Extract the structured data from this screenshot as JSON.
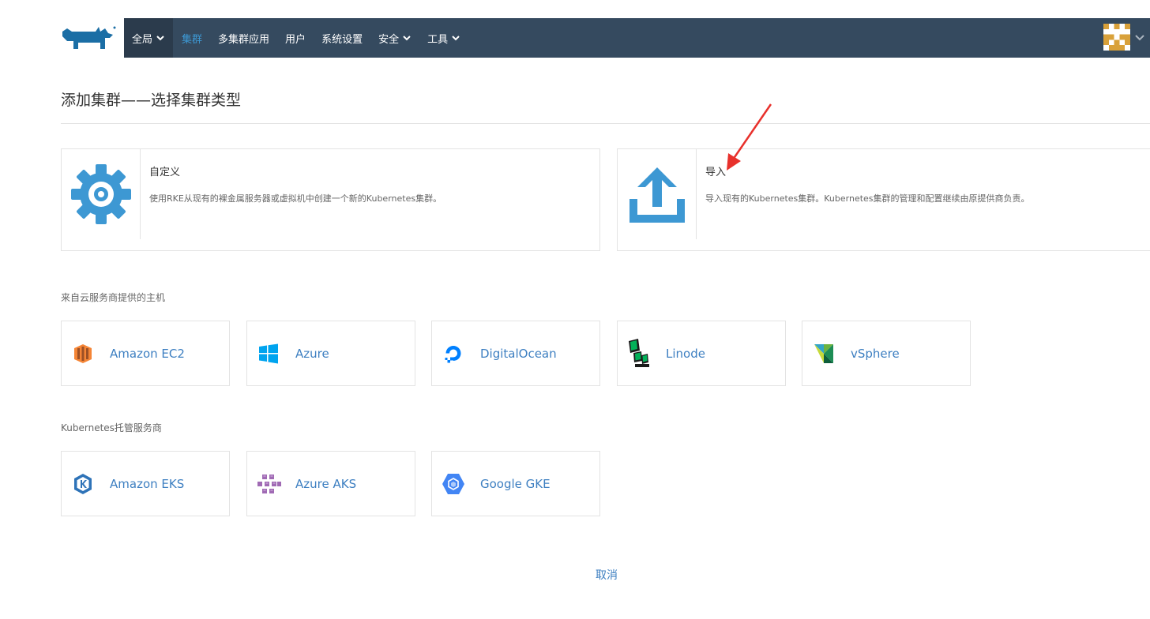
{
  "nav": {
    "global": "全局",
    "clusters": "集群",
    "multi_cluster_apps": "多集群应用",
    "users": "用户",
    "settings": "系统设置",
    "security": "安全",
    "tools": "工具"
  },
  "page": {
    "title": "添加集群——选择集群类型"
  },
  "custom_card": {
    "title": "自定义",
    "description": "使用RKE从现有的裸金属服务器或虚拟机中创建一个新的Kubernetes集群。",
    "icon": "gear-icon"
  },
  "import_card": {
    "title": "导入",
    "description": "导入现有的Kubernetes集群。Kubernetes集群的管理和配置继续由原提供商负责。",
    "icon": "upload-icon"
  },
  "cloud_section": {
    "label": "来自云服务商提供的主机",
    "providers": [
      {
        "label": "Amazon EC2",
        "icon": "amazon-ec2-icon"
      },
      {
        "label": "Azure",
        "icon": "azure-icon"
      },
      {
        "label": "DigitalOcean",
        "icon": "digitalocean-icon"
      },
      {
        "label": "Linode",
        "icon": "linode-icon"
      },
      {
        "label": "vSphere",
        "icon": "vsphere-icon"
      }
    ]
  },
  "hosted_section": {
    "label": "Kubernetes托管服务商",
    "providers": [
      {
        "label": "Amazon EKS",
        "icon": "amazon-eks-icon"
      },
      {
        "label": "Azure AKS",
        "icon": "azure-aks-icon"
      },
      {
        "label": "Google GKE",
        "icon": "google-gke-icon"
      }
    ]
  },
  "footer": {
    "cancel": "取消"
  },
  "colors": {
    "navbar": "#354a5f",
    "accent": "#3d98d3",
    "link": "#3d7fc1",
    "annotation_arrow": "#e8312c"
  }
}
